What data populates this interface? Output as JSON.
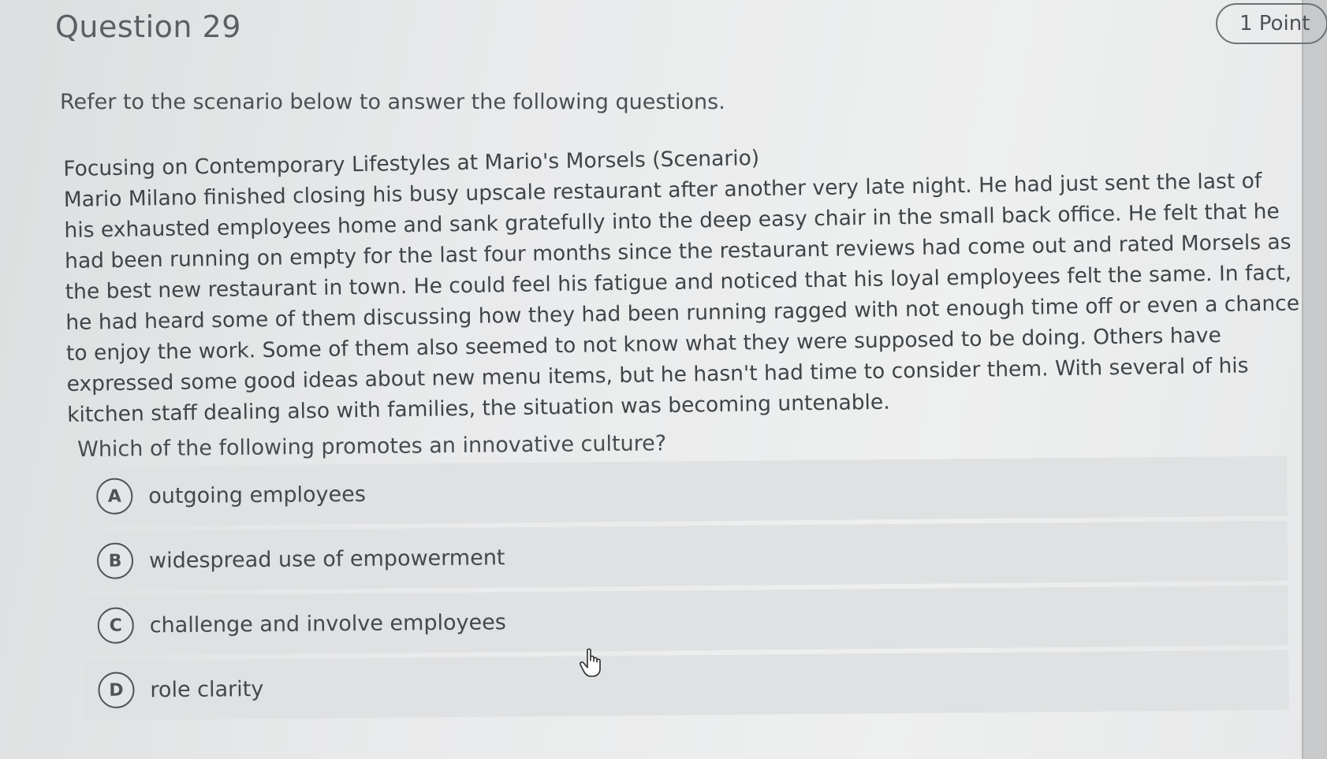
{
  "question": {
    "title": "Question 29",
    "points": "1 Point",
    "instructions": "Refer to the scenario below to answer the following questions.",
    "scenario_title": "Focusing on Contemporary Lifestyles at Mario's Morsels (Scenario)",
    "scenario_body": "Mario Milano finished closing his busy upscale restaurant after another very late night. He had just sent the last of his exhausted employees home and sank gratefully into the deep easy chair in the small back office. He felt that he had been running on empty for the last four months since the restaurant reviews had come out and rated Morsels as the best new restaurant in town. He could feel his fatigue and noticed that his loyal employees felt the same. In fact, he had heard some of them discussing how they had been running ragged with not enough time off or even a chance to enjoy the work. Some of them also seemed to not know what they were supposed to be doing. Others have expressed some good ideas about new menu items, but he hasn't had time to consider them. With several of his kitchen staff dealing also with families, the situation was becoming untenable.",
    "prompt": "Which of the following promotes an innovative culture?"
  },
  "options": [
    {
      "letter": "A",
      "label": "outgoing employees"
    },
    {
      "letter": "B",
      "label": "widespread use of empowerment"
    },
    {
      "letter": "C",
      "label": "challenge and involve employees"
    },
    {
      "letter": "D",
      "label": "role clarity"
    }
  ],
  "icons": {
    "cursor": "hand-pointer-icon"
  }
}
